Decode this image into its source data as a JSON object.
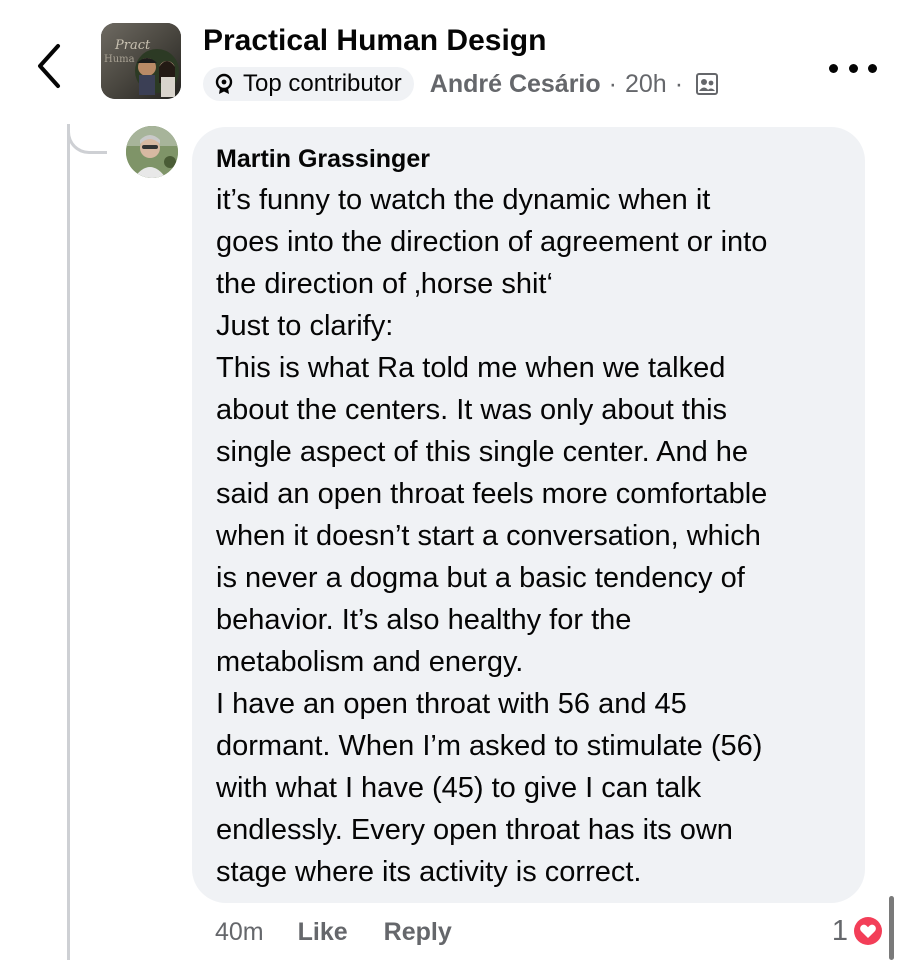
{
  "header": {
    "group_name": "Practical Human Design",
    "badge_label": "Top contributor",
    "author": "André Cesário",
    "separator": "·",
    "time": "20h",
    "separator2": "·",
    "avatar_text_1": "Pract",
    "avatar_text_2": "Huma"
  },
  "comment": {
    "author": "Martin Grassinger",
    "text": "it’s funny to watch the dynamic when it\ngoes into the direction of agreement or into\nthe direction of ‚horse shit‘\nJust to clarify:\nThis is what Ra told me when we talked\nabout the centers. It was only about this\nsingle aspect of this single center. And he\nsaid an open throat feels more comfortable\nwhen it doesn’t start a conversation, which\nis never a dogma but a basic tendency of\nbehavior. It’s also healthy for the\nmetabolism and energy.\nI have an open throat with 56 and 45\ndormant. When I’m asked to stimulate (56)\nwith what I have (45) to give I can talk\nendlessly. Every open throat has its own\nstage where its activity is correct.",
    "time": "40m",
    "like_label": "Like",
    "reply_label": "Reply",
    "reaction_count": "1"
  },
  "icons": {
    "back": "chevron-left-icon",
    "badge": "contributor-badge-icon",
    "privacy": "members-group-icon",
    "more": "more-options-icon",
    "reaction": "love-reaction-icon"
  },
  "colors": {
    "bubble": "#f0f2f5",
    "secondary_text": "#65676b",
    "love_reaction": "#f33e58"
  }
}
